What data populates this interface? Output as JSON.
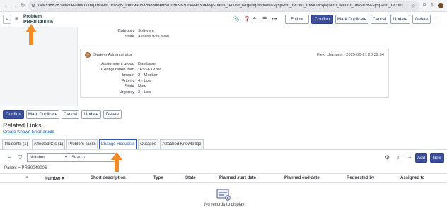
{
  "browser": {
    "url": "dev336826.service-now.com/problem.do?sys_id=29ad535583dee6501d9c9630ceaad304&sysparm_record_target=problem&sysparm_record_row=1&sysparm_record_rows=26&sysparm_record..."
  },
  "header": {
    "record_type": "Problem",
    "record_number": "PRB0040006",
    "buttons": [
      "Follow",
      "Confirm",
      "Mark Duplicate",
      "Cancel",
      "Update",
      "Delete"
    ]
  },
  "upper_fields": [
    {
      "label": "Category",
      "value": "Software"
    },
    {
      "label": "State",
      "value": "Assess  was  New"
    }
  ],
  "activity_card": {
    "author": "System Administrator",
    "meta": "Field changes  •  2025-06-21 23:32:04",
    "fields": [
      {
        "label": "Assignment group",
        "value": "Database"
      },
      {
        "label": "Configuration item",
        "value": "*ASSET-IBM"
      },
      {
        "label": "Impact",
        "value": "2 - Medium"
      },
      {
        "label": "Priority",
        "value": "4 - Low"
      },
      {
        "label": "State",
        "value": "New"
      },
      {
        "label": "Urgency",
        "value": "3 - Low"
      }
    ]
  },
  "bottom_buttons": [
    "Confirm",
    "Mark Duplicate",
    "Cancel",
    "Update",
    "Delete"
  ],
  "related": {
    "title": "Related Links",
    "link": "Create Known Error article"
  },
  "tabs": [
    {
      "label": "Incidents (1)",
      "active": false
    },
    {
      "label": "Affected CIs (1)",
      "active": false
    },
    {
      "label": "Problem Tasks",
      "active": false
    },
    {
      "label": "Change Requests",
      "active": true
    },
    {
      "label": "Outages",
      "active": false
    },
    {
      "label": "Attached Knowledge",
      "active": false
    }
  ],
  "list_toolbar": {
    "field_select": "Number",
    "search_placeholder": "Search",
    "add_label": "Add",
    "new_label": "New"
  },
  "breadcrumb": "Parent = PRB0040006",
  "table": {
    "columns": [
      "Number",
      "Short description",
      "Type",
      "State",
      "Planned start date",
      "Planned end date",
      "Requested by",
      "Assigned to"
    ]
  },
  "empty_state": "No records to display",
  "colors": {
    "primary_button": "#3c4f9b",
    "active_tab": "#2f56b8",
    "annotation_arrow": "#f28c28"
  }
}
